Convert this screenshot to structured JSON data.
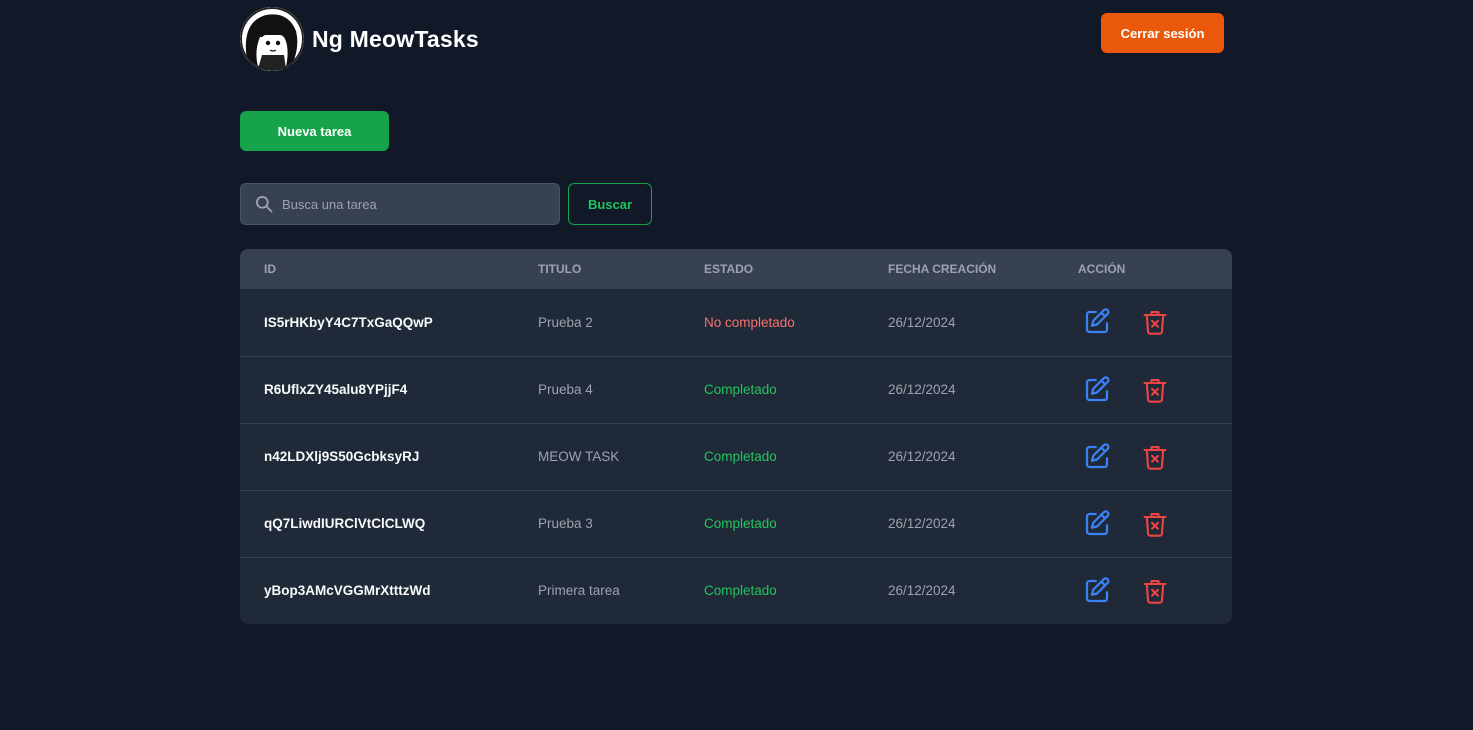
{
  "header": {
    "brand_name": "Ng MeowTasks",
    "logout_label": "Cerrar sesión"
  },
  "toolbar": {
    "new_task_label": "Nueva tarea"
  },
  "search": {
    "placeholder": "Busca una tarea",
    "value": "",
    "button_label": "Buscar"
  },
  "table": {
    "columns": [
      "ID",
      "TITULO",
      "ESTADO",
      "FECHA CREACIÓN",
      "ACCIÓN"
    ],
    "rows": [
      {
        "id": "IS5rHKbyY4C7TxGaQQwP",
        "title": "Prueba 2",
        "state": "No completado",
        "date": "26/12/2024"
      },
      {
        "id": "R6UflxZY45alu8YPjjF4",
        "title": "Prueba 4",
        "state": "Completado",
        "date": "26/12/2024"
      },
      {
        "id": "n42LDXlj9S50GcbksyRJ",
        "title": "MEOW TASK",
        "state": "Completado",
        "date": "26/12/2024"
      },
      {
        "id": "qQ7LiwdIURClVtClCLWQ",
        "title": "Prueba 3",
        "state": "Completado",
        "date": "26/12/2024"
      },
      {
        "id": "yBop3AMcVGGMrXtttzWd",
        "title": "Primera tarea",
        "state": "Completado",
        "date": "26/12/2024"
      }
    ]
  },
  "colors": {
    "background": "#111827",
    "logout": "#ea580c",
    "new_task": "#16a34a",
    "completed": "#22c55e",
    "not_completed": "#f87171",
    "edit_icon": "#3b82f6",
    "delete_icon": "#ef4444"
  },
  "icons": {
    "avatar": "cat-girl-avatar",
    "search": "search-icon",
    "edit": "edit-pencil-icon",
    "delete": "trash-icon"
  }
}
